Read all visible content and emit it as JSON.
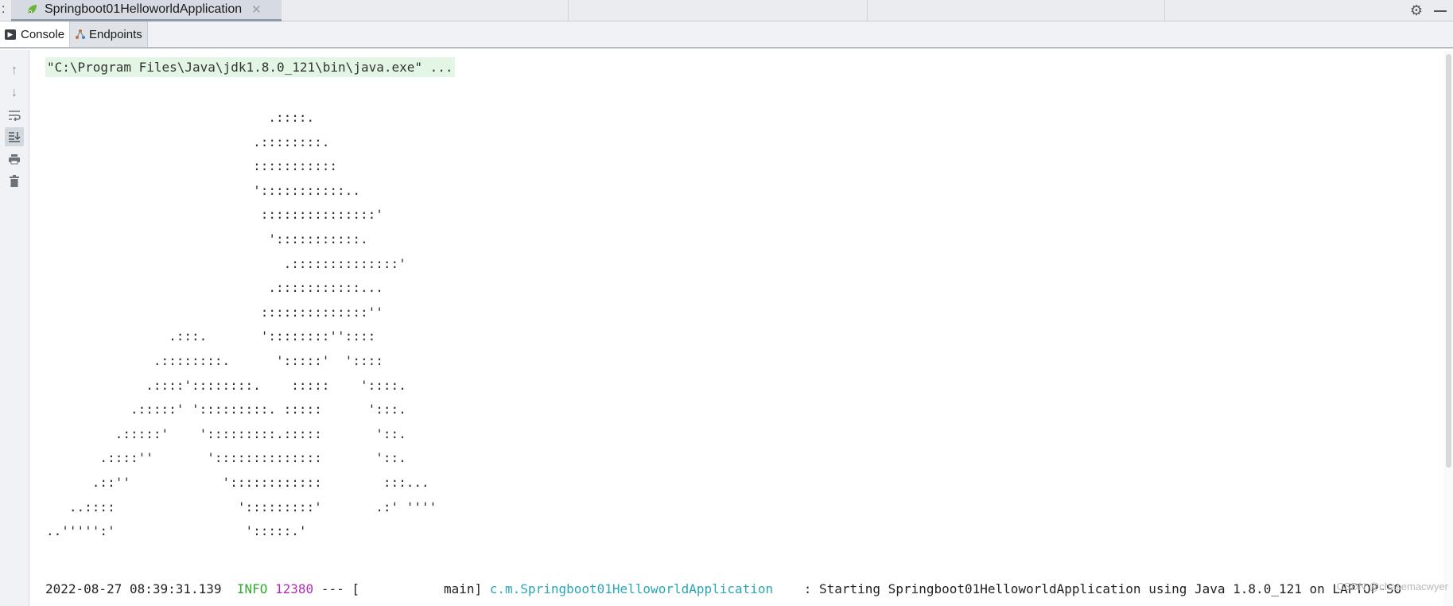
{
  "tabbar": {
    "colon": ":",
    "run_tab_label": "Springboot01HelloworldApplication",
    "close_glyph": "✕"
  },
  "subtabs": [
    {
      "label": "Console",
      "icon": "console-icon",
      "active": true
    },
    {
      "label": "Endpoints",
      "icon": "endpoints-icon",
      "active": false
    }
  ],
  "gutter": {
    "buttons": [
      "up-arrow-icon",
      "down-arrow-icon",
      "soft-wrap-icon",
      "scroll-to-end-icon",
      "print-icon",
      "trash-icon"
    ]
  },
  "console": {
    "command_line": "\"C:\\Program Files\\Java\\jdk1.8.0_121\\bin\\java.exe\" ...",
    "art_lines": [
      "                             .::::.",
      "                           .::::::::.",
      "                           :::::::::::",
      "                           ':::::::::::..",
      "                            :::::::::::::::'",
      "                             ':::::::::::.",
      "                               .::::::::::::::'",
      "                             .:::::::::::...",
      "                            ::::::::::::::''",
      "                .:::.       '::::::::''::::",
      "              .::::::::.      ':::::'  '::::",
      "             .::::'::::::::.    :::::    '::::.",
      "           .:::::' ':::::::::. :::::      ':::.",
      "         .:::::'    ':::::::::.:::::       '::.",
      "       .::::''       '::::::::::::::       '::.",
      "      .::''            '::::::::::::        :::...",
      "   ..::::                ':::::::::'       .:' ''''",
      "..''''':'                 ':::::.'"
    ],
    "log": {
      "timestamp": "2022-08-27 08:39:31.139",
      "level": "INFO",
      "pid": "12380",
      "separator": "--- [",
      "thread": "main]",
      "logger": "c.m.Springboot01HelloworldApplication",
      "message": ": Starting Springboot01HelloworldApplication using Java 1.8.0_121 on LAPTOP-SO"
    }
  },
  "watermark": "CSDN @chasemacwyer",
  "colors": {
    "info": "#2eaa2e",
    "pid": "#b02bb5",
    "logger": "#2aa7b7",
    "command_bg": "#e3f5e5"
  }
}
